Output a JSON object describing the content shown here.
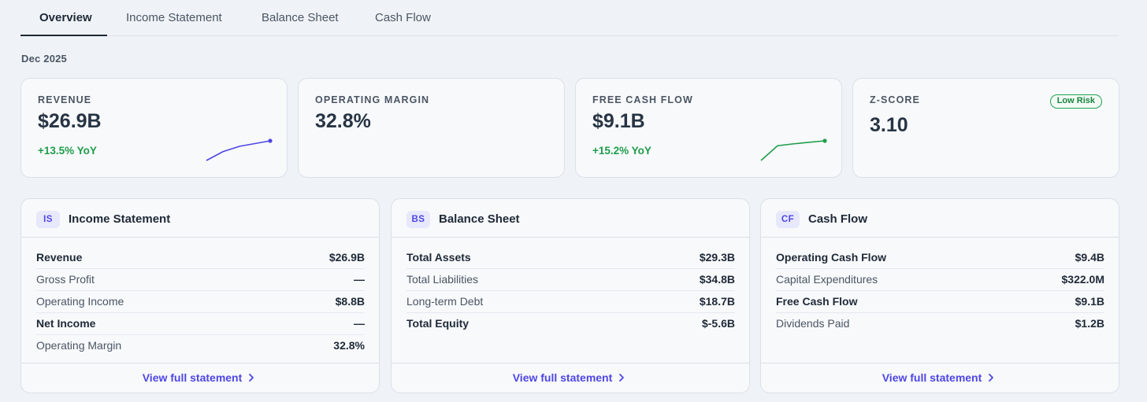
{
  "tabs": [
    {
      "label": "Overview",
      "active": true
    },
    {
      "label": "Income Statement",
      "active": false
    },
    {
      "label": "Balance Sheet",
      "active": false
    },
    {
      "label": "Cash Flow",
      "active": false
    }
  ],
  "period": "Dec 2025",
  "kpis": {
    "revenue": {
      "label": "REVENUE",
      "value": "$26.9B",
      "change": "+13.5% YoY",
      "spark_color": "#4f46e5",
      "trend": [
        0.0,
        0.45,
        0.72,
        1.0
      ]
    },
    "operating_margin": {
      "label": "OPERATING MARGIN",
      "value": "32.8%"
    },
    "free_cash_flow": {
      "label": "FREE CASH FLOW",
      "value": "$9.1B",
      "change": "+15.2% YoY",
      "spark_color": "#1f9d4a",
      "trend": [
        0.0,
        0.75,
        0.85,
        1.0
      ]
    },
    "z_score": {
      "label": "Z-SCORE",
      "value": "3.10",
      "badge": "Low Risk"
    }
  },
  "panels": {
    "income": {
      "badge": "IS",
      "title": "Income Statement",
      "rows": [
        {
          "label": "Revenue",
          "value": "$26.9B",
          "bold": true
        },
        {
          "label": "Gross Profit",
          "value": "—",
          "bold": false
        },
        {
          "label": "Operating Income",
          "value": "$8.8B",
          "bold": false
        },
        {
          "label": "Net Income",
          "value": "—",
          "bold": true
        },
        {
          "label": "Operating Margin",
          "value": "32.8%",
          "bold": false
        }
      ],
      "link": "View full statement"
    },
    "balance": {
      "badge": "BS",
      "title": "Balance Sheet",
      "rows": [
        {
          "label": "Total Assets",
          "value": "$29.3B",
          "bold": true
        },
        {
          "label": "Total Liabilities",
          "value": "$34.8B",
          "bold": false
        },
        {
          "label": "Long-term Debt",
          "value": "$18.7B",
          "bold": false
        },
        {
          "label": "Total Equity",
          "value": "$-5.6B",
          "bold": true
        }
      ],
      "link": "View full statement"
    },
    "cashflow": {
      "badge": "CF",
      "title": "Cash Flow",
      "rows": [
        {
          "label": "Operating Cash Flow",
          "value": "$9.4B",
          "bold": true
        },
        {
          "label": "Capital Expenditures",
          "value": "$322.0M",
          "bold": false
        },
        {
          "label": "Free Cash Flow",
          "value": "$9.1B",
          "bold": true
        },
        {
          "label": "Dividends Paid",
          "value": "$1.2B",
          "bold": false
        }
      ],
      "link": "View full statement"
    }
  },
  "colors": {
    "accent": "#4f46e5",
    "positive": "#1f9d4a",
    "text": "#1f2937"
  }
}
